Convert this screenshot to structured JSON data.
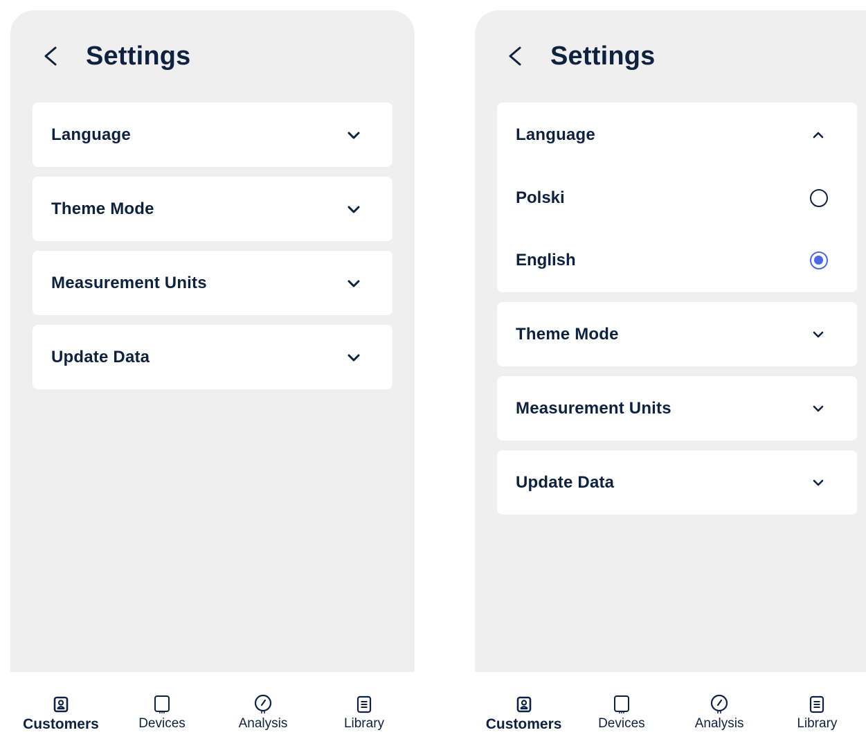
{
  "screens": [
    {
      "title": "Settings",
      "sections": [
        {
          "label": "Language"
        },
        {
          "label": "Theme Mode"
        },
        {
          "label": "Measurement Units"
        },
        {
          "label": "Update Data"
        }
      ]
    },
    {
      "title": "Settings",
      "language": {
        "label": "Language",
        "expanded": true,
        "options": [
          {
            "label": "Polski",
            "selected": false
          },
          {
            "label": "English",
            "selected": true
          }
        ]
      },
      "sections": [
        {
          "label": "Theme Mode"
        },
        {
          "label": "Measurement Units"
        },
        {
          "label": "Update Data"
        }
      ]
    }
  ],
  "nav": {
    "items": [
      {
        "label": "Customers",
        "icon": "contact-card-icon",
        "active": true
      },
      {
        "label": "Devices",
        "icon": "device-icon",
        "active": false
      },
      {
        "label": "Analysis",
        "icon": "gauge-icon",
        "active": false
      },
      {
        "label": "Library",
        "icon": "document-icon",
        "active": false
      }
    ]
  },
  "colors": {
    "text": "#0d2240",
    "background": "#efefef",
    "card": "#ffffff",
    "accent": "#4a67e8"
  }
}
